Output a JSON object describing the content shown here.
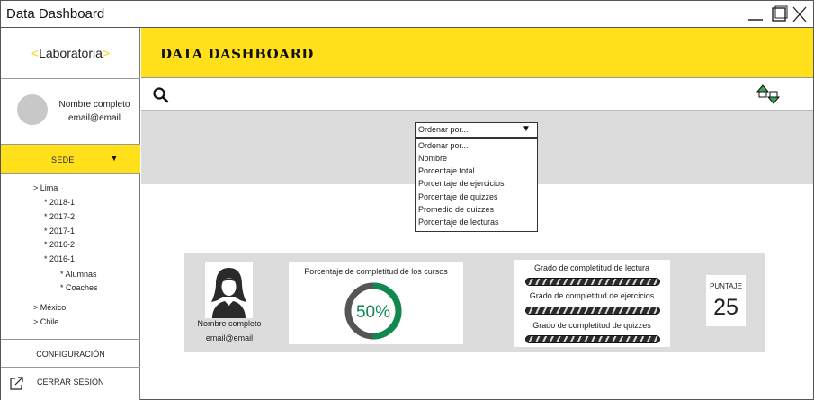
{
  "window": {
    "title": "Data Dashboard"
  },
  "sidebar": {
    "logo_text": "Laboratoria",
    "profile": {
      "name": "Nombre completo",
      "email": "email@email"
    },
    "sede": {
      "label": "SEDE"
    },
    "tree": [
      "> Lima",
      "* 2018-1",
      "* 2017-2",
      "* 2017-1",
      "* 2016-2",
      "* 2016-1",
      "* Alumnas",
      "* Coaches",
      "> México",
      "> Chile"
    ],
    "config_label": "CONFIGURACIÓN",
    "logout_label": "CERRAR SESIÓN"
  },
  "header": {
    "title": "DATA DASHBOARD"
  },
  "toolbar": {
    "search_icon": "search-icon",
    "sort_icon": "sort-toggle-icon"
  },
  "sort_dropdown": {
    "selected": "Ordenar por...",
    "options": [
      "Ordenar por...",
      "Nombre",
      "Porcentaje total",
      "Porcentaje de ejercicios",
      "Porcentaje de quizzes",
      "Promedio de quizzes",
      "Porcentaje de lecturas"
    ]
  },
  "student_card": {
    "name": "Nombre completo",
    "email": "email@email",
    "courses_label": "Porcentaje de completitud de los cursos",
    "courses_percent": 50,
    "courses_percent_text": "50%",
    "grades": [
      {
        "label": "Grado de completitud de lectura"
      },
      {
        "label": "Grado de completitud de ejercicios"
      },
      {
        "label": "Grado de completitud de quizzes"
      }
    ],
    "score_label": "PUNTAJE",
    "score_value": "25"
  },
  "colors": {
    "accent_yellow": "#ffe01b",
    "panel_gray": "#dcdcdc",
    "progress_green": "#0f8a4f",
    "progress_track": "#555555"
  }
}
